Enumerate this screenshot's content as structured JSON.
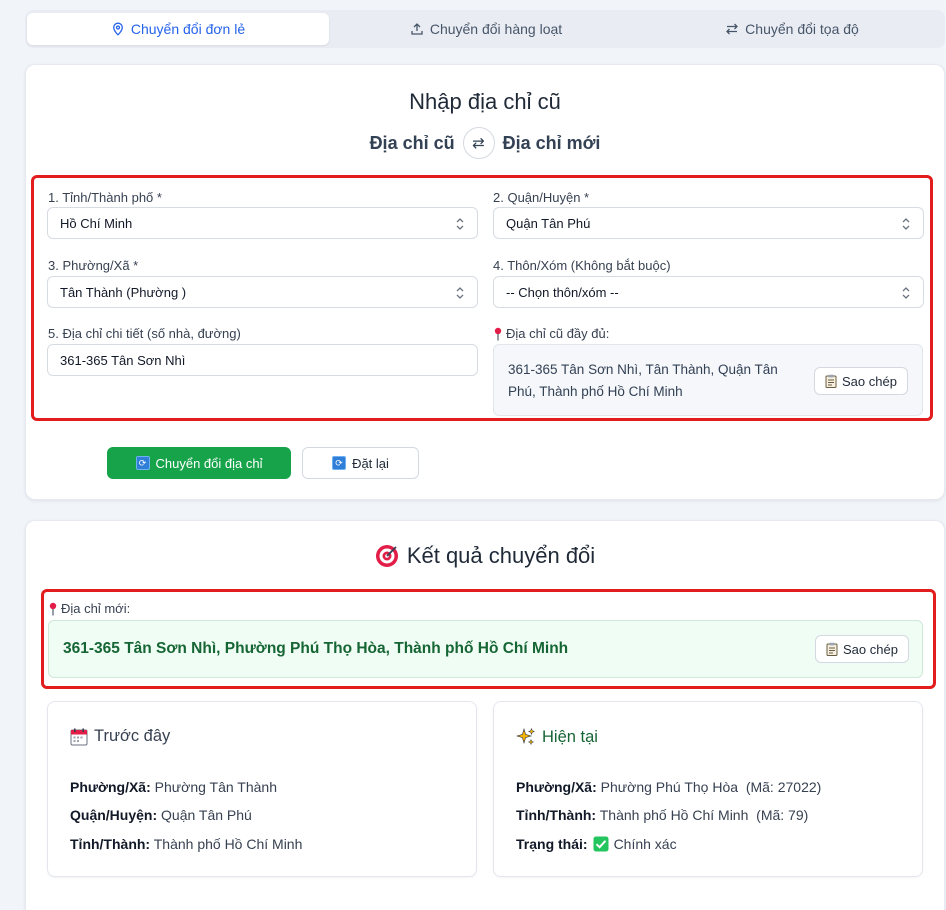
{
  "tabs": [
    {
      "label": "Chuyển đổi đơn lẻ",
      "icon": "map-pin-icon",
      "active": true
    },
    {
      "label": "Chuyển đổi hàng loạt",
      "icon": "upload-icon",
      "active": false
    },
    {
      "label": "Chuyển đổi tọa độ",
      "icon": "swap-arrows-icon",
      "active": false
    }
  ],
  "input_card": {
    "title": "Nhập địa chỉ cũ",
    "swap_left": "Địa chỉ cũ",
    "swap_right": "Địa chỉ mới",
    "province": {
      "label": "1. Tỉnh/Thành phố *",
      "value": "Hồ Chí Minh"
    },
    "district": {
      "label": "2. Quận/Huyện *",
      "value": "Quận Tân Phú"
    },
    "ward": {
      "label": "3. Phường/Xã *",
      "value": "Tân Thành (Phường )"
    },
    "hamlet": {
      "label": "4. Thôn/Xóm (Không bắt buộc)",
      "value": "-- Chọn thôn/xóm --"
    },
    "detail": {
      "label": "5. Địa chỉ chi tiết (số nhà, đường)",
      "value": "361-365 Tân Sơn Nhì"
    },
    "full_old": {
      "label": "Địa chỉ cũ đầy đủ:",
      "value": "361-365 Tân Sơn Nhì, Tân Thành, Quận Tân Phú, Thành phố Hồ Chí Minh"
    },
    "copy_label": "Sao chép",
    "convert_label": "Chuyển đổi địa chỉ",
    "reset_label": "Đặt lại"
  },
  "result_card": {
    "title": "Kết quả chuyển đổi",
    "new_addr_label": "Địa chỉ mới:",
    "new_addr_value": "361-365 Tân Sơn Nhì, Phường Phú Thọ Hòa, Thành phố Hồ Chí Minh",
    "copy_label": "Sao chép",
    "before": {
      "title": "Trước đây",
      "ward_key": "Phường/Xã:",
      "ward_val": "Phường Tân Thành",
      "district_key": "Quận/Huyện:",
      "district_val": "Quận Tân Phú",
      "province_key": "Tỉnh/Thành:",
      "province_val": "Thành phố Hồ Chí Minh"
    },
    "current": {
      "title": "Hiện tại",
      "ward_key": "Phường/Xã:",
      "ward_val": "Phường Phú Thọ Hòa  (Mã: 27022)",
      "province_key": "Tỉnh/Thành:",
      "province_val": "Thành phố Hồ Chí Minh  (Mã: 79)",
      "status_key": "Trạng thái:",
      "status_val": "Chính xác"
    }
  },
  "colors": {
    "accent_blue": "#2563eb",
    "green": "#16a34a",
    "highlight_red": "#e11d1d"
  }
}
